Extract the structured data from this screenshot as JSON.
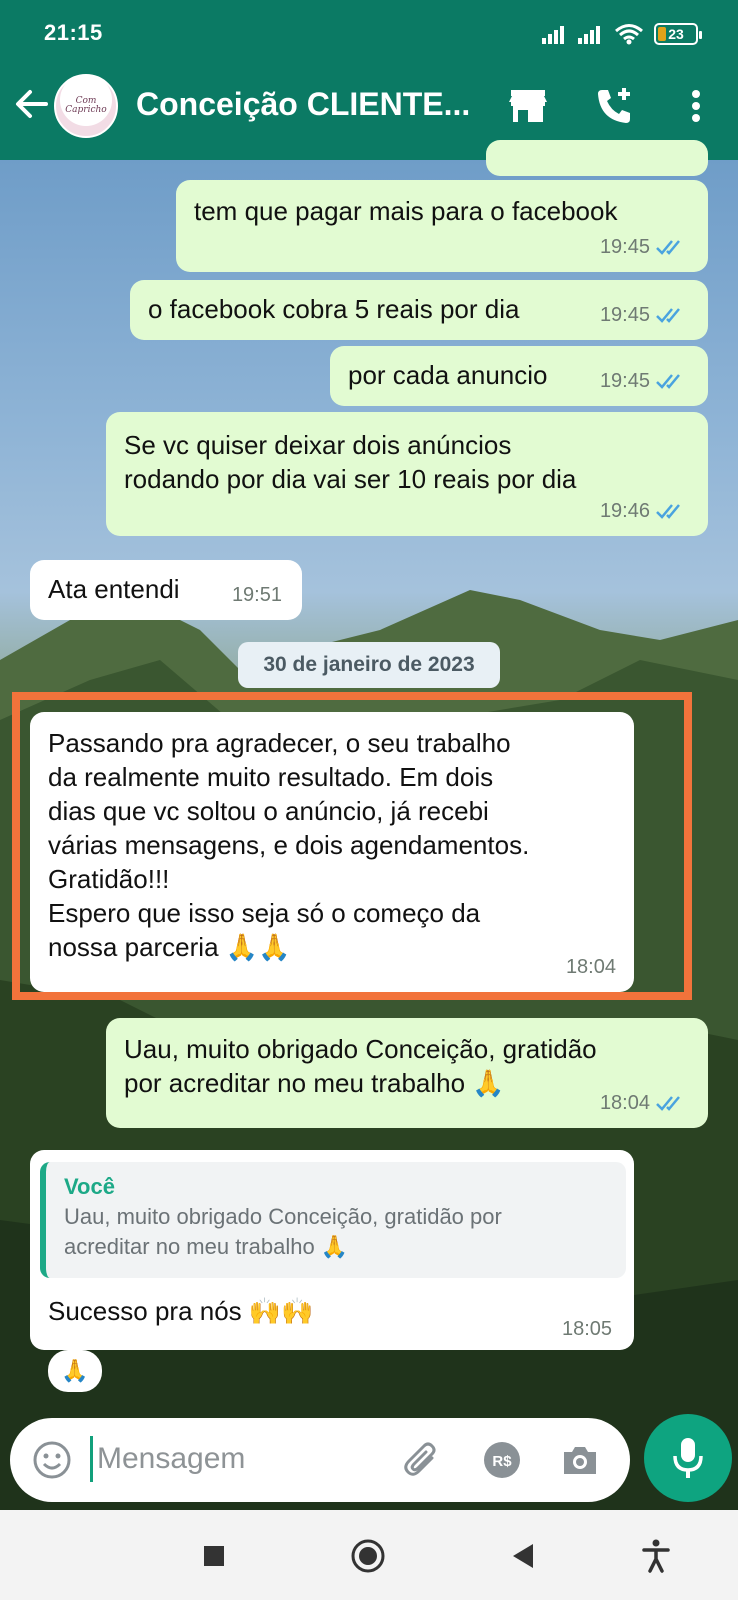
{
  "status_bar": {
    "time": "21:15",
    "battery": "23"
  },
  "header": {
    "title": "Conceição CLIENTE...",
    "avatar_text": "Com Capricho",
    "icons": [
      "back-arrow-icon",
      "store-icon",
      "add-call-icon",
      "more-vert-icon"
    ]
  },
  "messages": [
    {
      "direction": "out",
      "text": "tem que pagar mais para o facebook",
      "time": "19:45",
      "status": "read"
    },
    {
      "direction": "out",
      "text": "o facebook cobra 5 reais por dia",
      "time": "19:45",
      "status": "read"
    },
    {
      "direction": "out",
      "text": "por cada anuncio",
      "time": "19:45",
      "status": "read"
    },
    {
      "direction": "out",
      "text": "Se vc quiser deixar dois anúncios\nrodando por dia vai ser 10 reais por dia",
      "time": "19:46",
      "status": "read"
    },
    {
      "direction": "in",
      "text": "Ata entendi",
      "time": "19:51"
    },
    {
      "direction": "in",
      "text": "Passando pra agradecer, o seu trabalho\nda realmente muito resultado. Em dois\ndias que vc soltou o anúncio, já recebi\nvárias mensagens, e dois agendamentos.\nGratidão!!!\nEspero que isso seja só o começo da\nnossa parceria 🙏🙏",
      "time": "18:04"
    },
    {
      "direction": "out",
      "text": "Uau, muito obrigado Conceição, gratidão\npor acreditar no meu trabalho 🙏",
      "time": "18:04",
      "status": "read"
    },
    {
      "direction": "in",
      "text": "Sucesso pra nós 🙌🙌",
      "time": "18:05",
      "quote": {
        "author": "Você",
        "text": "Uau, muito obrigado Conceição, gratidão por\nacreditar no meu trabalho 🙏"
      }
    }
  ],
  "date_divider": "30 de janeiro de 2023",
  "reaction": "🙏",
  "composer": {
    "placeholder": "Mensagem"
  },
  "colors": {
    "header": "#0b7a64",
    "outgoing": "#e2fbd2",
    "incoming": "#ffffff",
    "accent": "#0ea480",
    "highlight_border": "#f2733b"
  }
}
